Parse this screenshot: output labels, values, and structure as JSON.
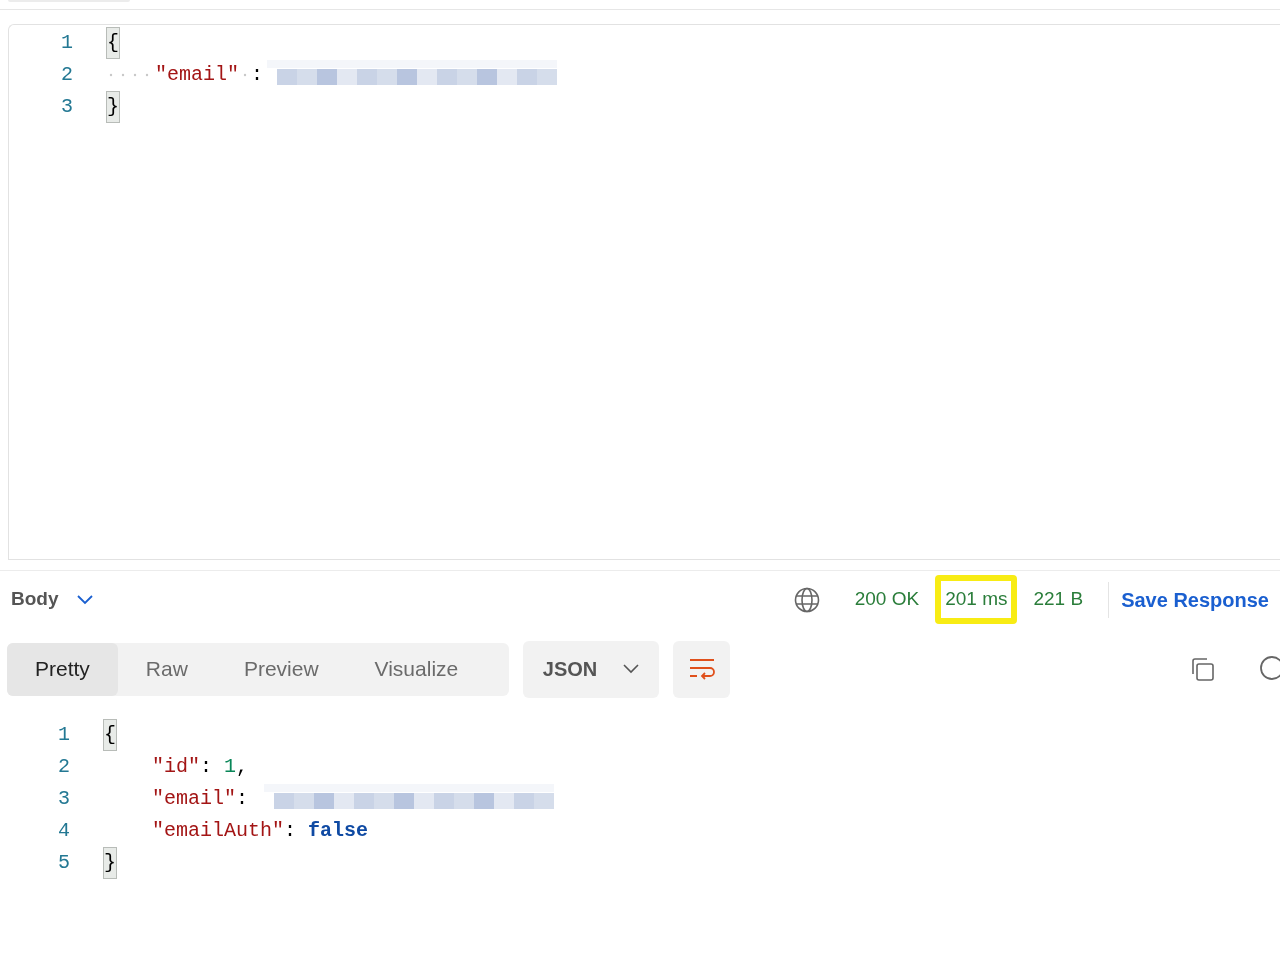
{
  "request_body": {
    "lines": [
      {
        "number": "1",
        "tokens": [
          {
            "kind": "matched-brace",
            "text": "{"
          }
        ]
      },
      {
        "number": "2",
        "tokens": [
          {
            "kind": "indent"
          },
          {
            "kind": "key",
            "text": "\"email\""
          },
          {
            "kind": "space-dot"
          },
          {
            "kind": "punct",
            "text": ":"
          },
          {
            "kind": "redacted"
          }
        ]
      },
      {
        "number": "3",
        "tokens": [
          {
            "kind": "matched-brace",
            "text": "}"
          }
        ]
      }
    ]
  },
  "response_bar": {
    "section": "Body",
    "stats": [
      {
        "text": "200 OK",
        "highlighted": false
      },
      {
        "text": "201 ms",
        "highlighted": true
      },
      {
        "text": "221 B",
        "highlighted": false
      }
    ],
    "save_label": "Save Response"
  },
  "view_tabs": [
    {
      "label": "Pretty",
      "selected": true
    },
    {
      "label": "Raw",
      "selected": false
    },
    {
      "label": "Preview",
      "selected": false
    },
    {
      "label": "Visualize",
      "selected": false
    }
  ],
  "format": "JSON",
  "response_body": {
    "lines": [
      {
        "number": "1",
        "tokens": [
          {
            "kind": "matched-brace",
            "text": "{"
          }
        ]
      },
      {
        "number": "2",
        "tokens": [
          {
            "kind": "indent"
          },
          {
            "kind": "key",
            "text": "\"id\""
          },
          {
            "kind": "punct",
            "text": ": "
          },
          {
            "kind": "number",
            "text": "1"
          },
          {
            "kind": "punct",
            "text": ","
          }
        ]
      },
      {
        "number": "3",
        "tokens": [
          {
            "kind": "indent"
          },
          {
            "kind": "key",
            "text": "\"email\""
          },
          {
            "kind": "punct",
            "text": ": "
          },
          {
            "kind": "redacted"
          }
        ]
      },
      {
        "number": "4",
        "tokens": [
          {
            "kind": "indent"
          },
          {
            "kind": "key",
            "text": "\"emailAuth\""
          },
          {
            "kind": "punct",
            "text": ": "
          },
          {
            "kind": "keyword",
            "text": "false"
          }
        ]
      },
      {
        "number": "5",
        "tokens": [
          {
            "kind": "matched-brace",
            "text": "}"
          }
        ]
      }
    ]
  }
}
